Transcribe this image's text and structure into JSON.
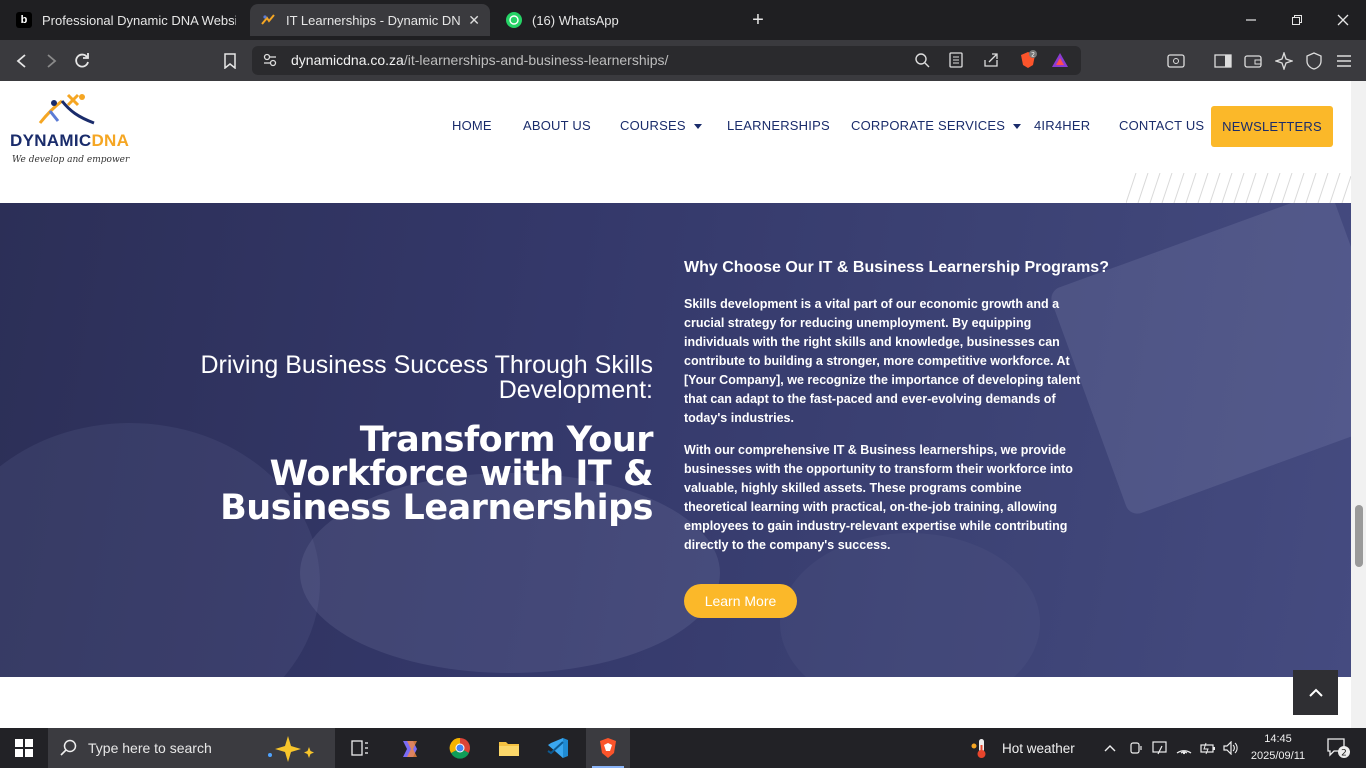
{
  "browser": {
    "tabs": [
      {
        "title": "Professional Dynamic DNA Website",
        "active": false
      },
      {
        "title": "IT Learnerships - Dynamic DNA I",
        "active": true
      },
      {
        "title": "(16) WhatsApp",
        "active": false
      }
    ],
    "address": {
      "host": "dynamicdna.co.za",
      "path": "/it-learnerships-and-business-learnerships/"
    },
    "shield_badge": "2"
  },
  "site": {
    "logo_word_1": "DYNAMIC",
    "logo_word_2": "DNA",
    "logo_tagline": "We develop and empower",
    "nav": [
      "HOME",
      "ABOUT US",
      "COURSES",
      "LEARNERSHIPS",
      "CORPORATE SERVICES",
      "4IR4HER",
      "CONTACT US"
    ],
    "newsletter": "NEWSLETTERS"
  },
  "hero": {
    "subtitle": "Driving Business Success Through Skills Development:",
    "title": "Transform Your Workforce with IT & Business Learnerships",
    "heading": "Why Choose Our IT & Business Learnership Programs?",
    "para1": "Skills development is a vital part of our economic growth and a crucial strategy for reducing unemployment. By equipping individuals with the right skills and knowledge, businesses can contribute to building a stronger, more competitive workforce. At [Your Company], we recognize the importance of developing talent that can adapt to the fast-paced and ever-evolving demands of today's industries.",
    "para2": "With our comprehensive IT & Business learnerships, we provide businesses with the opportunity to transform their workforce into valuable, highly skilled assets. These programs combine theoretical learning with practical, on-the-job training, allowing employees to gain industry-relevant expertise while contributing directly to the company's success.",
    "cta": "Learn More"
  },
  "taskbar": {
    "search_placeholder": "Type here to search",
    "weather": "Hot weather",
    "time": "14:45",
    "date": "2025/09/11",
    "notif_count": "2"
  },
  "colors": {
    "accent": "#fbb829",
    "navy": "#1a2c6b",
    "hero": "#34386a"
  }
}
